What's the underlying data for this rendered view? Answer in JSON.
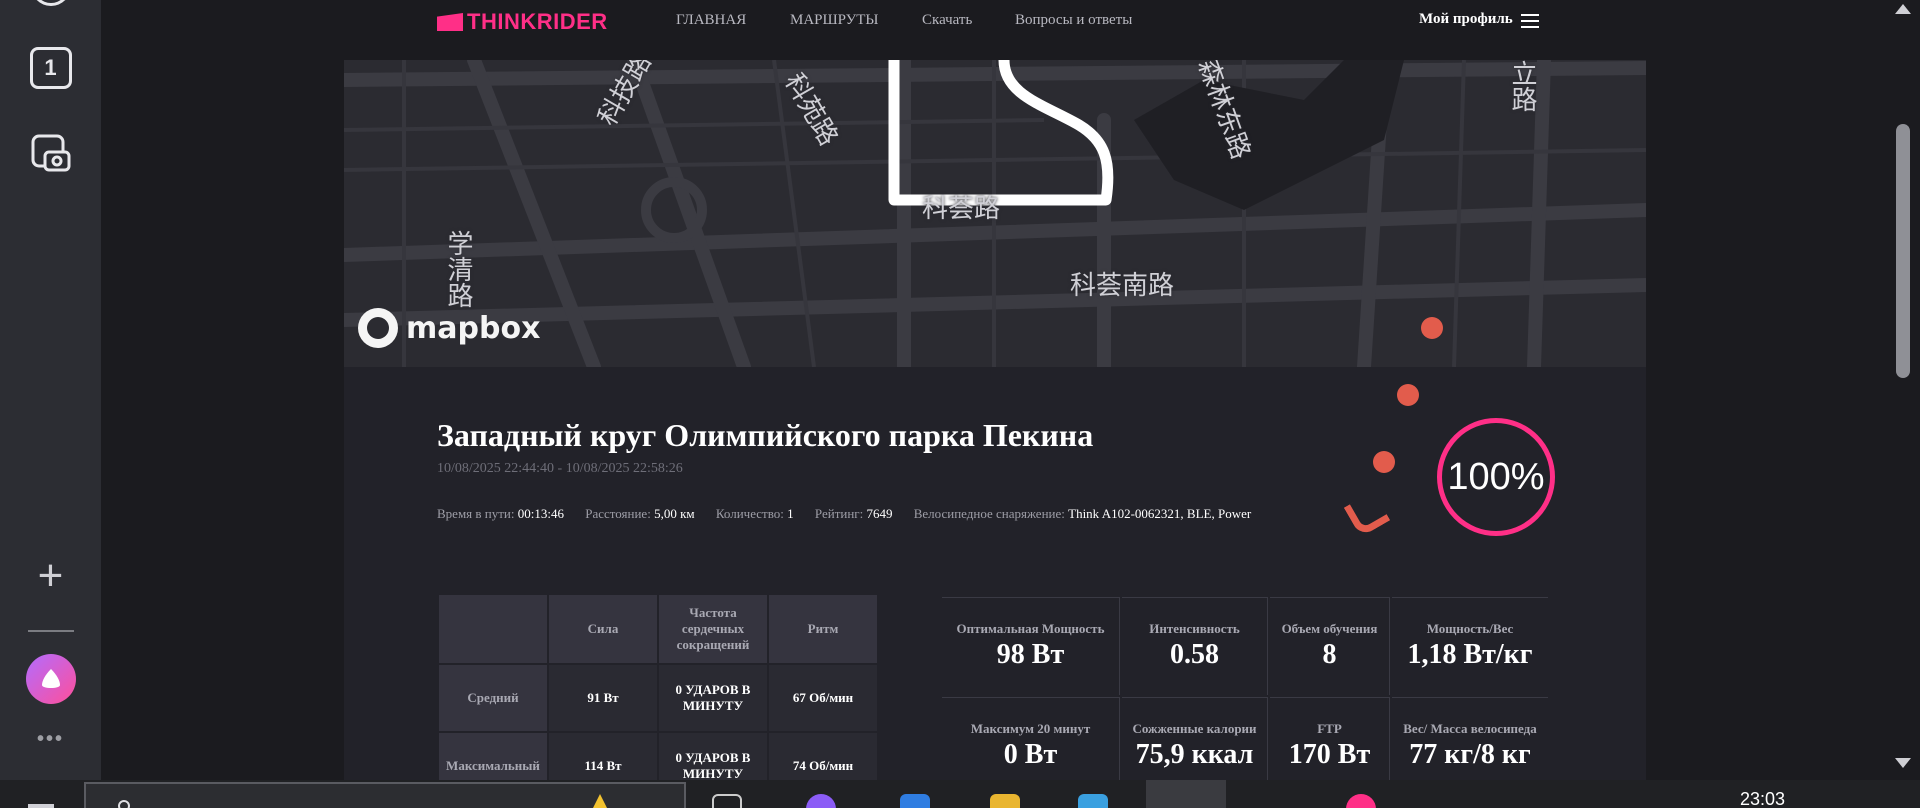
{
  "launcher": {
    "badge": "1",
    "add": "+",
    "more": "•••"
  },
  "header": {
    "logo": "THINKRIDER",
    "nav": [
      "ГЛАВНАЯ",
      "МАРШРУТЫ",
      "Скачать",
      "Вопросы и ответы"
    ],
    "profile": "Мой профиль"
  },
  "map": {
    "labels": [
      "科技路",
      "科苑路",
      "学清路",
      "科荟路",
      "科荟南路",
      "森林东路",
      "立路"
    ],
    "attribution": "mapbox"
  },
  "route": {
    "title": "Западный круг Олимпийского парка Пекина",
    "time_range": "10/08/2025 22:44:40 - 10/08/2025 22:58:26",
    "stats": [
      {
        "label": "Время в пути:",
        "value": "00:13:46"
      },
      {
        "label": "Расстояние:",
        "value": "5,00 км"
      },
      {
        "label": "Количество:",
        "value": "1"
      },
      {
        "label": "Рейтинг:",
        "value": "7649"
      },
      {
        "label": "Велосипедное снаряжение:",
        "value": "Think A102-0062321, BLE, Power"
      }
    ],
    "completion": "100%"
  },
  "table": {
    "headers": [
      "",
      "Сила",
      "Частота сердечных сокращений",
      "Ритм"
    ],
    "rows": [
      [
        "Средний",
        "91 Вт",
        "0 УДАРОВ В МИНУТУ",
        "67 Об/мин"
      ],
      [
        "Максимальный",
        "114 Вт",
        "0 УДАРОВ В МИНУТУ",
        "74 Об/мин"
      ]
    ]
  },
  "metrics": [
    {
      "label": "Оптимальная Мощность",
      "value": "98 Вт"
    },
    {
      "label": "Интенсивность",
      "value": "0.58"
    },
    {
      "label": "Объем обучения",
      "value": "8"
    },
    {
      "label": "Мощность/Вес",
      "value": "1,18 Вт/кг"
    },
    {
      "label": "Максимум 20 минут",
      "value": "0 Вт"
    },
    {
      "label": "Сожженные калории",
      "value": "75,9 ккал"
    },
    {
      "label": "FTP",
      "value": "170 Вт"
    },
    {
      "label": "Вес/ Масса велосипеда",
      "value": "77 кг/8 кг"
    }
  ],
  "taskbar": {
    "clock": "23:03"
  },
  "colors": {
    "accent": "#ff2f87",
    "background": "#1b1b1f",
    "panel": "#222229",
    "map": "#2b2b31",
    "dots": "#e25c4c"
  }
}
